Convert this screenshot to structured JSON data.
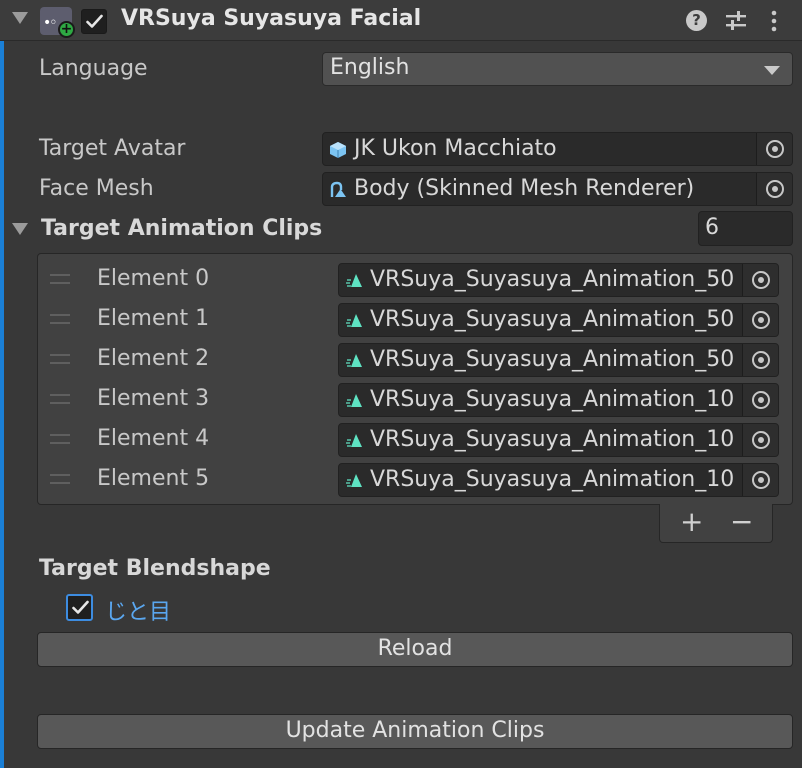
{
  "header": {
    "title": "VRSuya Suyasuya Facial",
    "enabled": true,
    "icons": [
      "script-icon",
      "help-icon",
      "presets-icon",
      "menu-icon"
    ]
  },
  "language": {
    "label": "Language",
    "selected": "English"
  },
  "target_avatar": {
    "label": "Target Avatar",
    "value": "JK Ukon Macchiato",
    "icon": "prefab-icon"
  },
  "face_mesh": {
    "label": "Face Mesh",
    "value": "Body (Skinned Mesh Renderer)",
    "icon": "skinned-mesh-icon"
  },
  "animation_clips": {
    "label": "Target Animation Clips",
    "count": "6",
    "items": [
      {
        "label": "Element 0",
        "value": "VRSuya_Suyasuya_Animation_50"
      },
      {
        "label": "Element 1",
        "value": "VRSuya_Suyasuya_Animation_50"
      },
      {
        "label": "Element 2",
        "value": "VRSuya_Suyasuya_Animation_50"
      },
      {
        "label": "Element 3",
        "value": "VRSuya_Suyasuya_Animation_10"
      },
      {
        "label": "Element 4",
        "value": "VRSuya_Suyasuya_Animation_10"
      },
      {
        "label": "Element 5",
        "value": "VRSuya_Suyasuya_Animation_10"
      }
    ],
    "add_label": "+",
    "remove_label": "−"
  },
  "blendshape": {
    "label": "Target Blendshape",
    "options": [
      {
        "label": "じと目",
        "checked": true
      }
    ]
  },
  "buttons": {
    "reload": "Reload",
    "update": "Update Animation Clips"
  },
  "colors": {
    "accent": "#1a7fd6",
    "checkbox_border": "#3d8ce0",
    "checked_label": "#5aa7f0",
    "animation_icon": "#5fe3c3",
    "add_badge": "#2ea843"
  }
}
